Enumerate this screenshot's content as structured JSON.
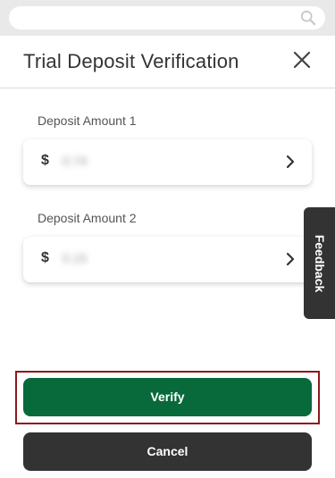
{
  "search": {
    "icon": "search-icon"
  },
  "header": {
    "title": "Trial Deposit Verification",
    "close_icon": "close-icon"
  },
  "deposits": [
    {
      "label": "Deposit Amount 1",
      "currency": "$",
      "value": "0.74"
    },
    {
      "label": "Deposit Amount 2",
      "currency": "$",
      "value": "0.15"
    }
  ],
  "feedback": {
    "label": "Feedback"
  },
  "actions": {
    "verify_label": "Verify",
    "cancel_label": "Cancel"
  },
  "colors": {
    "verify": "#08693a",
    "cancel": "#333333",
    "highlight": "#8b1a1a"
  }
}
